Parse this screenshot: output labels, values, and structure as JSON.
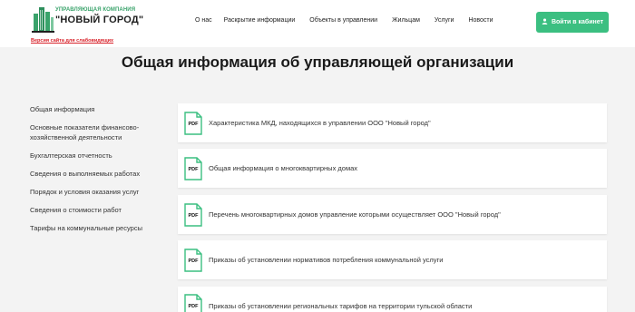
{
  "header": {
    "logo_top": "УПРАВЛЯЮЩАЯ КОМПАНИЯ",
    "logo_name": "\"НОВЫЙ ГОРОД\"",
    "blind_version": "Версия сайта для слабовидящих",
    "nav": [
      "О нас",
      "Раскрытие информации",
      "Объекты в управлении",
      "Жильцам",
      "Услуги",
      "Новости"
    ],
    "login_label": "Войти в кабинет"
  },
  "page_title": "Общая информация об управляющей организации",
  "sidebar": {
    "items": [
      "Общая информация",
      "Основные показатели финансово-хозяйственной деятельности",
      "Бухгалтерская отчетность",
      "Сведения о выполняемых работах",
      "Порядок и условия оказания услуг",
      "Сведения о стоимости работ",
      "Тарифы на коммунальные ресурсы"
    ]
  },
  "documents": {
    "icon_label": "PDF",
    "items": [
      "Характеристика МКД, находящихся в управлении ООО \"Новый город\"",
      "Общая информация о многоквартирных домах",
      "Перечень многоквартирных домов управление которыми осуществляет ООО \"Новый город\"",
      "Приказы об установлении нормативов потребления коммунальной услуги",
      "Приказы об установлении региональных тарифов на территории тульской области"
    ]
  },
  "colors": {
    "accent": "#3bbf81",
    "logo_green": "#3aa36b",
    "warning_red": "#d8222a"
  }
}
